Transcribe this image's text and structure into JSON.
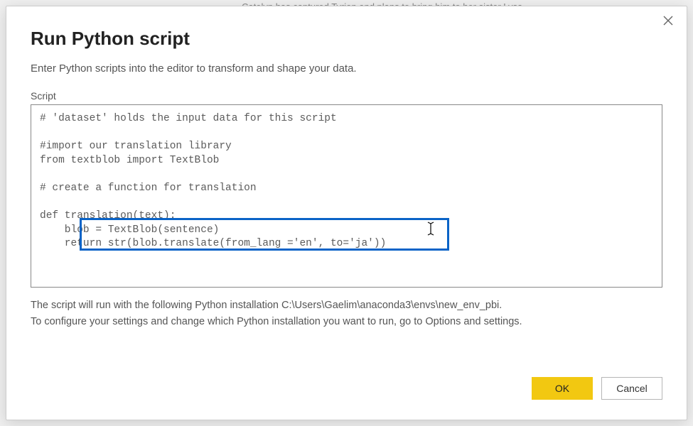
{
  "background": {
    "partial_text": "Catelyn has captured Tyrion and plans to bring him to her sister Lysa"
  },
  "dialog": {
    "title": "Run Python script",
    "subtitle": "Enter Python scripts into the editor to transform and shape your data.",
    "script_label": "Script",
    "script_content": "# 'dataset' holds the input data for this script\n\n#import our translation library\nfrom textblob import TextBlob\n\n# create a function for translation\n\ndef translation(text):\n    blob = TextBlob(sentence)\n    return str(blob.translate(from_lang ='en', to='ja'))",
    "footer_line1": "The script will run with the following Python installation C:\\Users\\Gaelim\\anaconda3\\envs\\new_env_pbi.",
    "footer_line2": "To configure your settings and change which Python installation you want to run, go to Options and settings.",
    "ok_label": "OK",
    "cancel_label": "Cancel"
  }
}
